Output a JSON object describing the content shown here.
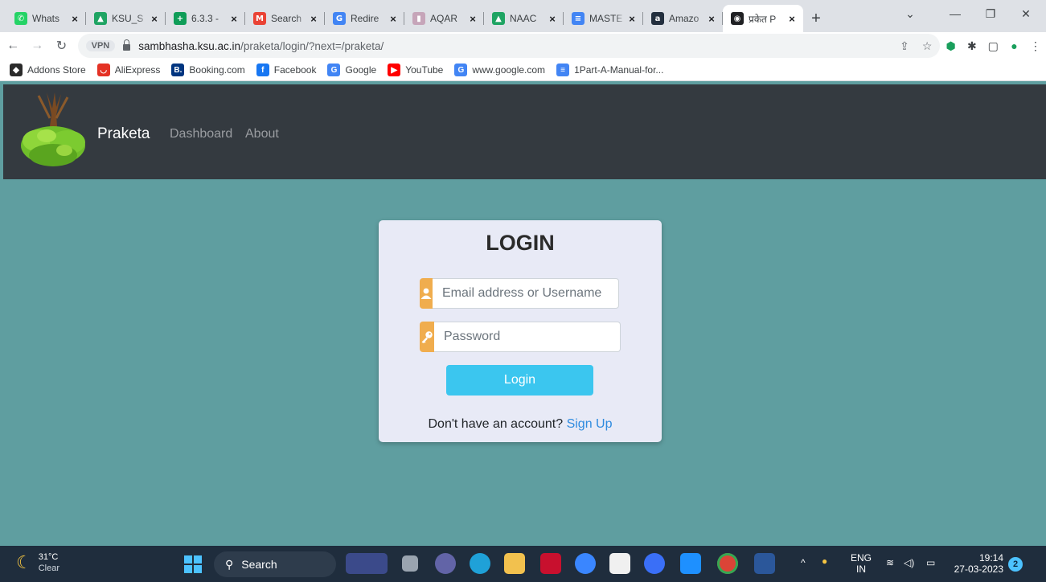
{
  "browser": {
    "tabs": [
      {
        "title": "Whats",
        "favicon": "whatsapp-icon",
        "color": "#25d366",
        "glyph": "✆"
      },
      {
        "title": "KSU_S",
        "favicon": "google-drive-icon",
        "color": "#1fa463",
        "glyph": "▲"
      },
      {
        "title": "6.3.3 -",
        "favicon": "google-sheets-icon",
        "color": "#0f9d58",
        "glyph": "+"
      },
      {
        "title": "Search",
        "favicon": "gmail-icon",
        "color": "#ea4335",
        "glyph": "M"
      },
      {
        "title": "Redire",
        "favicon": "google-icon",
        "color": "#4285f4",
        "glyph": "G"
      },
      {
        "title": "AQAR",
        "favicon": "bar-chart-icon",
        "color": "#c6a5b9",
        "glyph": "▮"
      },
      {
        "title": "NAAC",
        "favicon": "google-drive-icon",
        "color": "#1fa463",
        "glyph": "▲"
      },
      {
        "title": "MASTE",
        "favicon": "google-docs-icon",
        "color": "#4285f4",
        "glyph": "≡"
      },
      {
        "title": "Amazo",
        "favicon": "amazon-icon",
        "color": "#232f3e",
        "glyph": "a"
      },
      {
        "title": "प्रकेत P",
        "favicon": "globe-icon",
        "color": "#202124",
        "glyph": "◉",
        "active": true
      }
    ],
    "url_host": "sambhasha.ksu.ac.in",
    "url_path": "/praketa/login/?next=/praketa/",
    "vpn_label": "VPN"
  },
  "bookmarks": [
    {
      "label": "Addons Store",
      "icon": "addons-store-icon",
      "color": "#2b2b2b",
      "glyph": "◆"
    },
    {
      "label": "AliExpress",
      "icon": "aliexpress-icon",
      "color": "#e43225",
      "glyph": "◡"
    },
    {
      "label": "Booking.com",
      "icon": "booking-icon",
      "color": "#003580",
      "glyph": "B."
    },
    {
      "label": "Facebook",
      "icon": "facebook-icon",
      "color": "#1877f2",
      "glyph": "f"
    },
    {
      "label": "Google",
      "icon": "google-icon",
      "color": "#4285f4",
      "glyph": "G"
    },
    {
      "label": "YouTube",
      "icon": "youtube-icon",
      "color": "#ff0000",
      "glyph": "▶"
    },
    {
      "label": "www.google.com",
      "icon": "google-icon",
      "color": "#4285f4",
      "glyph": "G"
    },
    {
      "label": "1Part-A-Manual-for...",
      "icon": "google-docs-icon",
      "color": "#4285f4",
      "glyph": "≡"
    }
  ],
  "site": {
    "brand": "Praketa",
    "nav": {
      "dashboard": "Dashboard",
      "about": "About"
    }
  },
  "login": {
    "title": "LOGIN",
    "username_placeholder": "Email address or Username",
    "password_placeholder": "Password",
    "button": "Login",
    "signup_prompt": "Don't have an account?",
    "signup_link": "Sign Up",
    "accent_color": "#f0ad4e",
    "button_color": "#3bc6ef"
  },
  "taskbar": {
    "weather_temp": "31°C",
    "weather_desc": "Clear",
    "search_label": "Search",
    "lang_top": "ENG",
    "lang_bottom": "IN",
    "time": "19:14",
    "date": "27-03-2023",
    "notification_count": "2"
  }
}
